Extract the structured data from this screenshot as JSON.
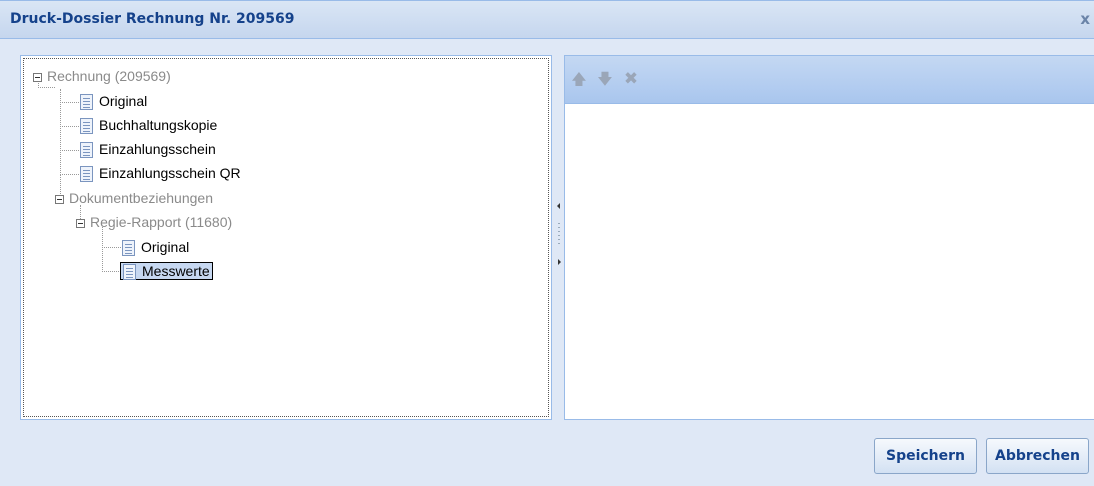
{
  "window": {
    "title": "Druck-Dossier Rechnung Nr. 209569",
    "close_label": "x"
  },
  "tree": {
    "root": {
      "label": "Rechnung (209569)"
    },
    "root_children": [
      {
        "label": "Original"
      },
      {
        "label": "Buchhaltungskopie"
      },
      {
        "label": "Einzahlungsschein"
      },
      {
        "label": "Einzahlungsschein QR"
      }
    ],
    "relations": {
      "label": "Dokumentbeziehungen"
    },
    "report": {
      "label": "Regie-Rapport (11680)"
    },
    "report_children": [
      {
        "label": "Original"
      },
      {
        "label": "Messwerte",
        "selected": true
      }
    ]
  },
  "toolbar": {
    "up_icon": "arrow-up-icon",
    "down_icon": "arrow-down-icon",
    "delete_icon": "delete-icon"
  },
  "buttons": {
    "save": "Speichern",
    "cancel": "Abbrechen"
  },
  "colors": {
    "title": "#15428b",
    "panel_border": "#99bbe8",
    "selection": "#c7d8f1"
  }
}
